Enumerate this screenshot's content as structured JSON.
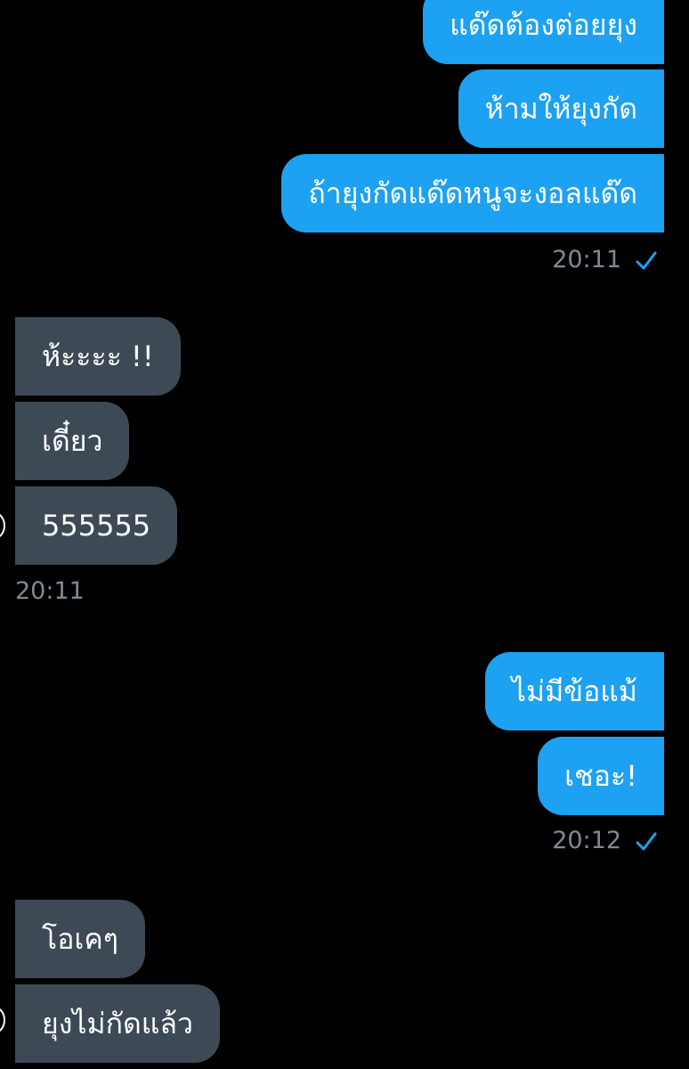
{
  "conversation": {
    "group1": {
      "messages": [
        "แด๊ดต้องต่อยยุง",
        "ห้ามให้ยุงกัด",
        "ถ้ายุงกัดแด๊ดหนูจะงอลแด๊ด"
      ],
      "time": "20:11",
      "status_icon": "check-icon"
    },
    "group2": {
      "messages": [
        "ห้ะะะะ !!",
        "เดี๋ยว",
        "555555"
      ],
      "time": "20:11"
    },
    "group3": {
      "messages": [
        "ไม่มีข้อแม้",
        "เชอะ!"
      ],
      "time": "20:12",
      "status_icon": "check-icon"
    },
    "group4": {
      "messages": [
        "โอเคๆ",
        "ยุงไม่กัดแล้ว"
      ]
    }
  },
  "colors": {
    "background": "#000000",
    "outgoing_bubble": "#1da1f2",
    "incoming_bubble": "#3d4a55",
    "timestamp": "#7e8b96",
    "check": "#1da1f2"
  }
}
